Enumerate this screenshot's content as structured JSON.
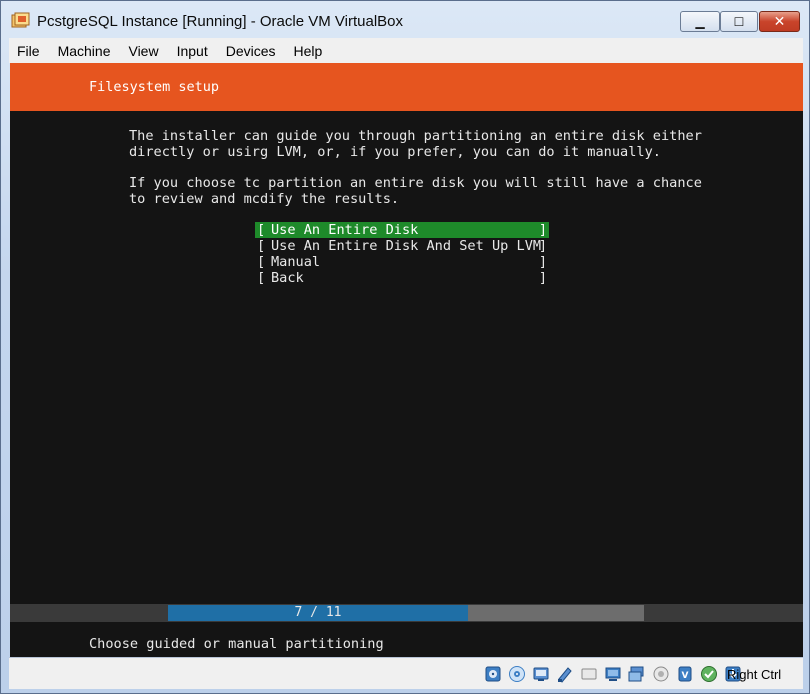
{
  "window": {
    "title": "PcstgreSQL Instance [Running] - Oracle VM VirtualBox",
    "controls": {
      "minimize": "▁",
      "maximize": "☐",
      "close": "✕"
    }
  },
  "menubar": {
    "items": [
      "File",
      "Machine",
      "View",
      "Input",
      "Devices",
      "Help"
    ]
  },
  "installer": {
    "header_title": "Filesystem setup",
    "paragraph1": "The installer can guide you through partitioning an entire disk either\ndirectly or usirg LVM, or, if you prefer, you can do it manually.",
    "paragraph2": "If you choose tc partition an entire disk you will still have a chance\nto review and mcdify the results.",
    "options": [
      {
        "label": "Use An Entire Disk",
        "selected": true
      },
      {
        "label": "Use An Entire Disk And Set Up LVM",
        "selected": false
      },
      {
        "label": "Manual",
        "selected": false
      },
      {
        "label": "Back",
        "selected": false
      }
    ],
    "bracket_left": "[",
    "bracket_right": "]",
    "progress": {
      "text": "7 / 11",
      "current": 7,
      "total": 11
    },
    "status_text": "Choose guided or manual partitioning"
  },
  "statusbar": {
    "icons": [
      "hard-disk-icon",
      "optical-disc-icon",
      "audio-icon",
      "network-icon",
      "usb-icon",
      "shared-folder-icon",
      "display-icon",
      "video-capture-icon",
      "cpu-icon",
      "mouse-integration-icon",
      "keyboard-icon"
    ],
    "host_key": "Right Ctrl"
  },
  "colors": {
    "header_orange": "#e6551f",
    "selected_green": "#1e8a2a",
    "progress_blue": "#1f6fa6",
    "terminal_bg": "#141414"
  }
}
